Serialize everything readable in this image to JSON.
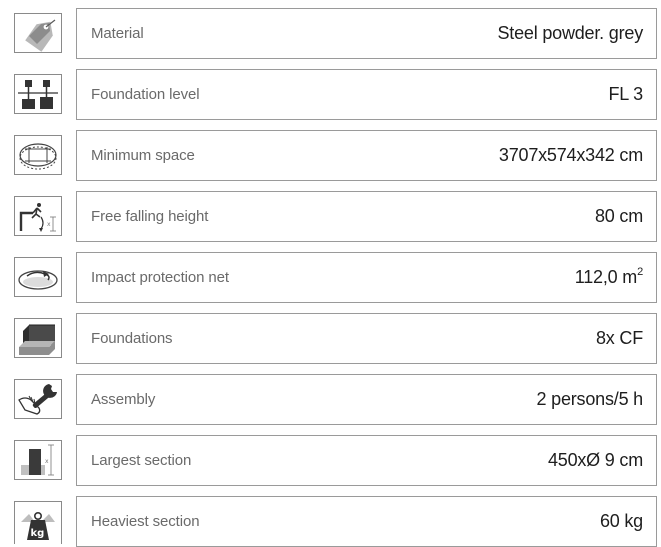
{
  "specs": [
    {
      "icon": "price-tag-icon",
      "label": "Material",
      "value": "Steel powder. grey",
      "unit_sup": ""
    },
    {
      "icon": "foundation-level-icon",
      "label": "Foundation level",
      "value": "FL 3",
      "unit_sup": ""
    },
    {
      "icon": "minimum-space-icon",
      "label": "Minimum space",
      "value": "3707x574x342 cm",
      "unit_sup": ""
    },
    {
      "icon": "falling-height-icon",
      "label": "Free falling height",
      "value": "80 cm",
      "unit_sup": ""
    },
    {
      "icon": "impact-net-icon",
      "label": "Impact protection net",
      "value": "112,0 m",
      "unit_sup": "2"
    },
    {
      "icon": "foundation-block-icon",
      "label": "Foundations",
      "value": "8x CF",
      "unit_sup": ""
    },
    {
      "icon": "assembly-wrench-icon",
      "label": "Assembly",
      "value": "2 persons/5 h",
      "unit_sup": ""
    },
    {
      "icon": "largest-section-icon",
      "label": "Largest section",
      "value": "450xØ 9 cm",
      "unit_sup": ""
    },
    {
      "icon": "kg-weight-icon",
      "label": "Heaviest section",
      "value": "60 kg",
      "unit_sup": "",
      "icon_text": "kg"
    }
  ]
}
